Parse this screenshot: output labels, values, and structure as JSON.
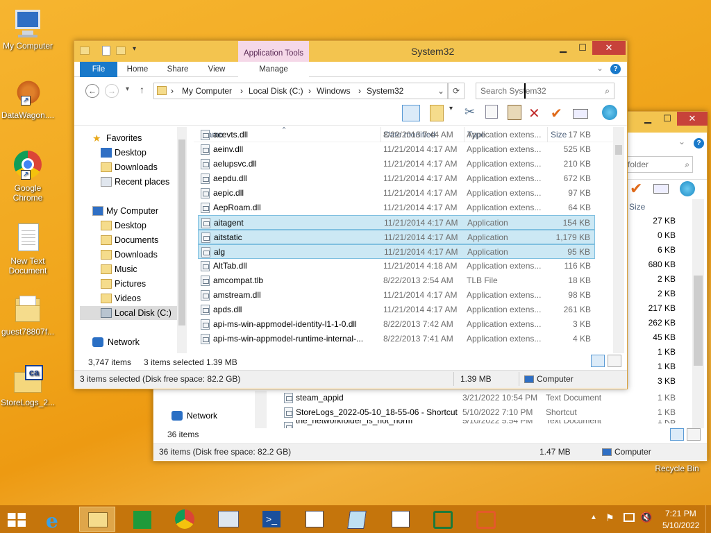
{
  "desktop": {
    "icons": [
      {
        "label": "My Computer"
      },
      {
        "label": "DataWagon...."
      },
      {
        "label": "Google Chrome"
      },
      {
        "label": "New Text Document"
      },
      {
        "label": "guest78807f..."
      },
      {
        "label": "StoreLogs_2..."
      }
    ],
    "recycle_bin": "Recycle Bin"
  },
  "back_window": {
    "search_placeholder": "folder",
    "size_header": "Size",
    "sizes": [
      "27 KB",
      "0 KB",
      "6 KB",
      "680 KB",
      "2 KB",
      "2 KB",
      "217 KB",
      "262 KB",
      "45 KB",
      "1 KB",
      "1 KB",
      "3 KB",
      "1 KB",
      "1 KB"
    ],
    "files": [
      {
        "name": "steam_appid",
        "date": "3/21/2022 10:54 PM",
        "type": "Text Document",
        "size": "1 KB"
      },
      {
        "name": "StoreLogs_2022-05-10_18-55-06 - Shortcut",
        "date": "5/10/2022 7:10 PM",
        "type": "Shortcut",
        "size": "1 KB"
      },
      {
        "name": "the_networkfolder_is_not_norm",
        "date": "5/10/2022 5:54 PM",
        "type": "Text Document",
        "size": "1 KB"
      }
    ],
    "network": "Network",
    "item_count": "36 items",
    "status_left": "36 items (Disk free space: 82.2 GB)",
    "status_size": "1.47 MB",
    "status_loc": "Computer"
  },
  "front_window": {
    "title": "System32",
    "context_tab": "Application Tools",
    "tabs": {
      "file": "File",
      "home": "Home",
      "share": "Share",
      "view": "View",
      "manage": "Manage"
    },
    "breadcrumb": [
      "My Computer",
      "Local Disk (C:)",
      "Windows",
      "System32"
    ],
    "search_placeholder": "Search System32",
    "nav": {
      "favorites": "Favorites",
      "desktop": "Desktop",
      "downloads": "Downloads",
      "recent": "Recent places",
      "mycomputer": "My Computer",
      "desktop2": "Desktop",
      "documents": "Documents",
      "downloads2": "Downloads",
      "music": "Music",
      "pictures": "Pictures",
      "videos": "Videos",
      "localdisk": "Local Disk (C:)",
      "network": "Network"
    },
    "columns": {
      "name": "Name",
      "date": "Date modified",
      "type": "Type",
      "size": "Size"
    },
    "files": [
      {
        "name": "acevts.dll",
        "date": "8/22/2013 7:44 AM",
        "type": "Application extens...",
        "size": "17 KB"
      },
      {
        "name": "aeinv.dll",
        "date": "11/21/2014 4:17 AM",
        "type": "Application extens...",
        "size": "525 KB"
      },
      {
        "name": "aelupsvc.dll",
        "date": "11/21/2014 4:17 AM",
        "type": "Application extens...",
        "size": "210 KB"
      },
      {
        "name": "aepdu.dll",
        "date": "11/21/2014 4:17 AM",
        "type": "Application extens...",
        "size": "672 KB"
      },
      {
        "name": "aepic.dll",
        "date": "11/21/2014 4:17 AM",
        "type": "Application extens...",
        "size": "97 KB"
      },
      {
        "name": "AepRoam.dll",
        "date": "11/21/2014 4:17 AM",
        "type": "Application extens...",
        "size": "64 KB"
      },
      {
        "name": "aitagent",
        "date": "11/21/2014 4:17 AM",
        "type": "Application",
        "size": "154 KB"
      },
      {
        "name": "aitstatic",
        "date": "11/21/2014 4:17 AM",
        "type": "Application",
        "size": "1,179 KB"
      },
      {
        "name": "alg",
        "date": "11/21/2014 4:17 AM",
        "type": "Application",
        "size": "95 KB"
      },
      {
        "name": "AltTab.dll",
        "date": "11/21/2014 4:18 AM",
        "type": "Application extens...",
        "size": "116 KB"
      },
      {
        "name": "amcompat.tlb",
        "date": "8/22/2013 2:54 AM",
        "type": "TLB File",
        "size": "18 KB"
      },
      {
        "name": "amstream.dll",
        "date": "11/21/2014 4:17 AM",
        "type": "Application extens...",
        "size": "98 KB"
      },
      {
        "name": "apds.dll",
        "date": "11/21/2014 4:17 AM",
        "type": "Application extens...",
        "size": "261 KB"
      },
      {
        "name": "api-ms-win-appmodel-identity-l1-1-0.dll",
        "date": "8/22/2013 7:42 AM",
        "type": "Application extens...",
        "size": "3 KB"
      },
      {
        "name": "api-ms-win-appmodel-runtime-internal-...",
        "date": "8/22/2013 7:41 AM",
        "type": "Application extens...",
        "size": "4 KB"
      }
    ],
    "item_count": "3,747 items",
    "selected_count": "3 items selected  1.39 MB",
    "status_left": "3 items selected (Disk free space: 82.2 GB)",
    "status_size": "1.39 MB",
    "status_loc": "Computer"
  },
  "taskbar": {
    "time": "7:21 PM",
    "date": "5/10/2022"
  },
  "colors": {
    "accent": "#1979ca",
    "selection": "#cce8f4",
    "titlebar": "#f3c44f",
    "close": "#c7423a"
  }
}
